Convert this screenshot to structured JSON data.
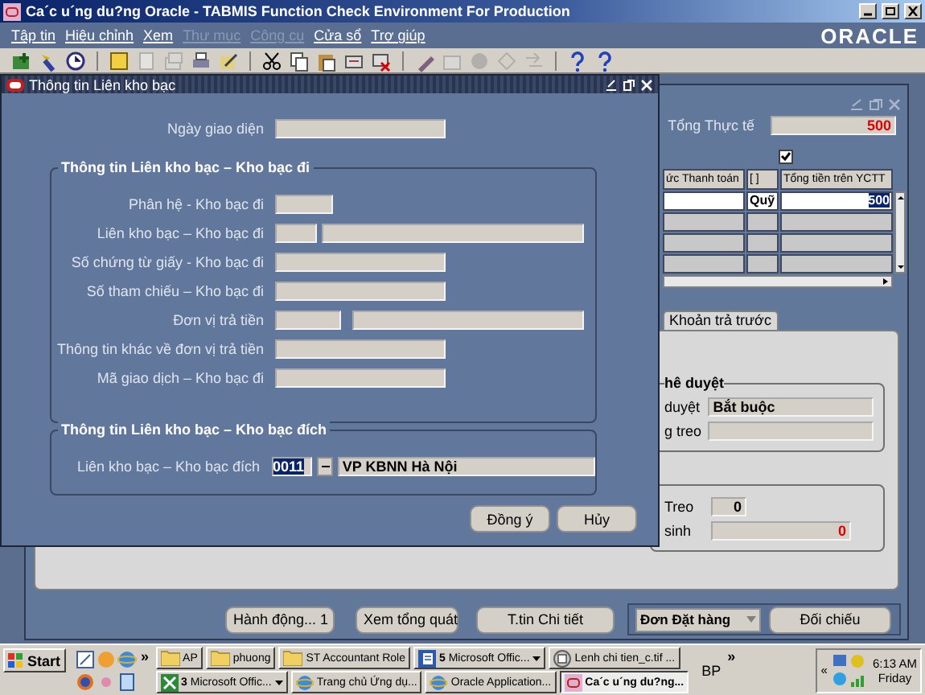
{
  "window": {
    "title": "Ca´c u´ng du?ng Oracle - TABMIS Function Check Environment For Production"
  },
  "menu": [
    {
      "label": "Tập tin",
      "disabled": false
    },
    {
      "label": "Hiệu chỉnh",
      "disabled": false
    },
    {
      "label": "Xem",
      "disabled": false
    },
    {
      "label": "Thư mục",
      "disabled": true
    },
    {
      "label": "Công cụ",
      "disabled": true
    },
    {
      "label": "Cửa sổ",
      "disabled": false
    },
    {
      "label": "Trợ giúp",
      "disabled": false
    }
  ],
  "logo": "ORACLE",
  "toolbar": [
    {
      "kind": "new",
      "disabled": false
    },
    {
      "kind": "find",
      "disabled": false
    },
    {
      "kind": "clock",
      "disabled": false
    },
    {
      "kind": "sep"
    },
    {
      "kind": "note",
      "disabled": false
    },
    {
      "kind": "page",
      "disabled": true
    },
    {
      "kind": "stack",
      "disabled": true
    },
    {
      "kind": "print",
      "disabled": false
    },
    {
      "kind": "pen",
      "disabled": false
    },
    {
      "kind": "sep"
    },
    {
      "kind": "cut",
      "disabled": false
    },
    {
      "kind": "copy",
      "disabled": false
    },
    {
      "kind": "paste",
      "disabled": false
    },
    {
      "kind": "clip",
      "disabled": false
    },
    {
      "kind": "delete",
      "disabled": false
    },
    {
      "kind": "sep"
    },
    {
      "kind": "pencil",
      "disabled": false
    },
    {
      "kind": "box",
      "disabled": true
    },
    {
      "kind": "circle",
      "disabled": true
    },
    {
      "kind": "diamond",
      "disabled": true
    },
    {
      "kind": "arrows",
      "disabled": true
    },
    {
      "kind": "sep"
    },
    {
      "kind": "help",
      "disabled": false
    },
    {
      "kind": "help",
      "disabled": false
    }
  ],
  "dialog": {
    "title": "Thông tin Liên kho bạc",
    "date_field": {
      "label": "Ngày giao diện",
      "kind": "medium"
    },
    "source_group": {
      "legend": "Thông tin Liên kho bạc – Kho bạc đi",
      "fields": [
        {
          "label": "Phân hệ - Kho bạc đi",
          "kind": "short"
        },
        {
          "label": "Liên kho bạc – Kho bạc đi",
          "kind": "pair"
        },
        {
          "label": "Số chứng từ giấy - Kho bạc đi",
          "kind": "medium"
        },
        {
          "label": "Số tham chiếu – Kho bạc đi",
          "kind": "medium"
        },
        {
          "label": "Đơn vị trả tiền",
          "kind": "split"
        },
        {
          "label": "Thông tin khác về đơn vị trả tiền",
          "kind": "medium"
        },
        {
          "label": "Mã giao dịch – Kho bạc đi",
          "kind": "medium"
        }
      ]
    },
    "dest_group": {
      "legend": "Thông tin Liên kho bạc – Kho bạc đích",
      "field": {
        "label": "Liên kho bạc – Kho bạc đích",
        "code": "0011",
        "code_selected": true,
        "name": "VP KBNN Hà Nội"
      }
    },
    "buttons": [
      "Đồng ý",
      "Hủy"
    ]
  },
  "form": {
    "total": {
      "label": "Tổng Thực tế",
      "value": "500",
      "highlight": true
    },
    "checkbox": {
      "checked": true
    },
    "table": {
      "columns": [
        "ức Thanh toán",
        "[ ]",
        "Tổng tiền trên YCTT"
      ],
      "rows": [
        {
          "selected": true,
          "cells": [
            "",
            "Quỹ",
            "500"
          ]
        },
        {
          "selected": false,
          "cells": [
            "",
            "",
            ""
          ]
        },
        {
          "selected": false,
          "cells": [
            "",
            "",
            ""
          ]
        },
        {
          "selected": false,
          "cells": [
            "",
            "",
            ""
          ]
        }
      ]
    },
    "tabs": [
      {
        "label": "Khoản trả trước",
        "selected": true
      }
    ],
    "approval_group": {
      "legend": "hê duyệt",
      "rows": [
        {
          "label": "duyệt",
          "value": "Bắt buộc"
        },
        {
          "label": "g treo"
        }
      ]
    },
    "balance_group": {
      "rows": [
        {
          "label": "Treo",
          "value": "0",
          "highlight": false
        },
        {
          "label": "sinh",
          "value": "0",
          "highlight": true
        }
      ]
    },
    "buttons": [
      "Hành động... 1",
      "Xem tổng quát",
      "T.tin Chi tiết"
    ],
    "dropdown": {
      "value": "Đơn Đặt hàng"
    },
    "match_button": "Đối chiếu"
  },
  "taskbar": {
    "start": "Start",
    "quick_more": "»",
    "tasks": [
      {
        "label": "AP",
        "kind": "folder",
        "grouped": false,
        "selected": false
      },
      {
        "label": "phuong",
        "kind": "folder",
        "grouped": false,
        "selected": false
      },
      {
        "label": "ST Accountant Role",
        "kind": "folder",
        "grouped": false,
        "selected": false
      },
      {
        "label": "**5** Microsoft Offic...",
        "kind": "word",
        "grouped": true,
        "selected": false
      },
      {
        "label": "Lenh chi tien_c.tif ...",
        "kind": "image",
        "grouped": false,
        "selected": false
      },
      {
        "label": "**3** Microsoft Offic...",
        "kind": "excel",
        "grouped": true,
        "selected": false
      },
      {
        "label": "Trang chủ Ứng dụ...",
        "kind": "browser",
        "grouped": false,
        "selected": false
      },
      {
        "label": "Oracle Application...",
        "kind": "browser",
        "grouped": false,
        "selected": false
      },
      {
        "label": "Ca´c u´ng du?ng...",
        "kind": "oracle",
        "grouped": false,
        "selected": true
      }
    ],
    "lang": "BP",
    "tray_more": "»",
    "tray_back": "«",
    "time": "6:13 AM",
    "day": "Friday"
  }
}
